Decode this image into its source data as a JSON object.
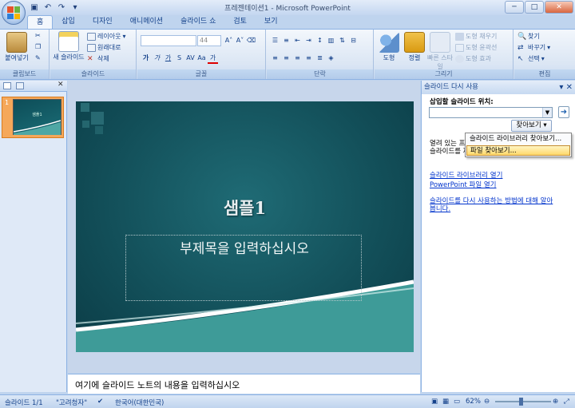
{
  "window": {
    "title": "프레젠테이션1 - Microsoft PowerPoint",
    "minimize": "─",
    "maximize": "□",
    "close": "✕"
  },
  "tabs": [
    "홈",
    "삽입",
    "디자인",
    "애니메이션",
    "슬라이드 쇼",
    "검토",
    "보기"
  ],
  "ribbon": {
    "clipboard": {
      "label": "클립보드",
      "paste": "붙여넣기"
    },
    "slides": {
      "label": "슬라이드",
      "new_slide": "새 슬라이드",
      "layout": "레이아웃",
      "reset": "원래대로",
      "delete": "삭제"
    },
    "font": {
      "label": "글꼴",
      "size": "44"
    },
    "paragraph": {
      "label": "단락"
    },
    "drawing": {
      "label": "그리기",
      "shape": "도형",
      "arrange": "정렬",
      "quick_style": "빠른 스타일",
      "fill": "도형 채우기",
      "outline": "도형 윤곽선",
      "effect": "도형 효과"
    },
    "editing": {
      "label": "편집",
      "find": "찾기",
      "replace": "바꾸기",
      "select": "선택"
    }
  },
  "slide_panel": {
    "number": "1"
  },
  "slide": {
    "title": "샘플1",
    "subtitle": "부제목을 입력하십시오"
  },
  "notes": {
    "placeholder": "여기에 슬라이드 노트의 내용을 입력하십시오"
  },
  "task_pane": {
    "title": "슬라이드 다시 사용",
    "insert_label": "삽입할 슬라이드 위치:",
    "browse": "찾아보기",
    "description": "열려 있는 프레젠테이션 또는 라이브러리를 찾아 슬라이드를 재사용할 수 있습니다.",
    "link_library": "슬라이드 라이브러리 열기",
    "link_file": "PowerPoint 파일 열기",
    "link_help": "슬라이드를 다시 사용하는 방법에 대해 알아봅니다."
  },
  "browse_menu": [
    "슬라이드 라이브러리 찾아보기...",
    "파일 찾아보기..."
  ],
  "status": {
    "slide": "슬라이드 1/1",
    "theme": "\"고려청자\"",
    "language": "한국어(대한민국)",
    "zoom": "62%"
  }
}
